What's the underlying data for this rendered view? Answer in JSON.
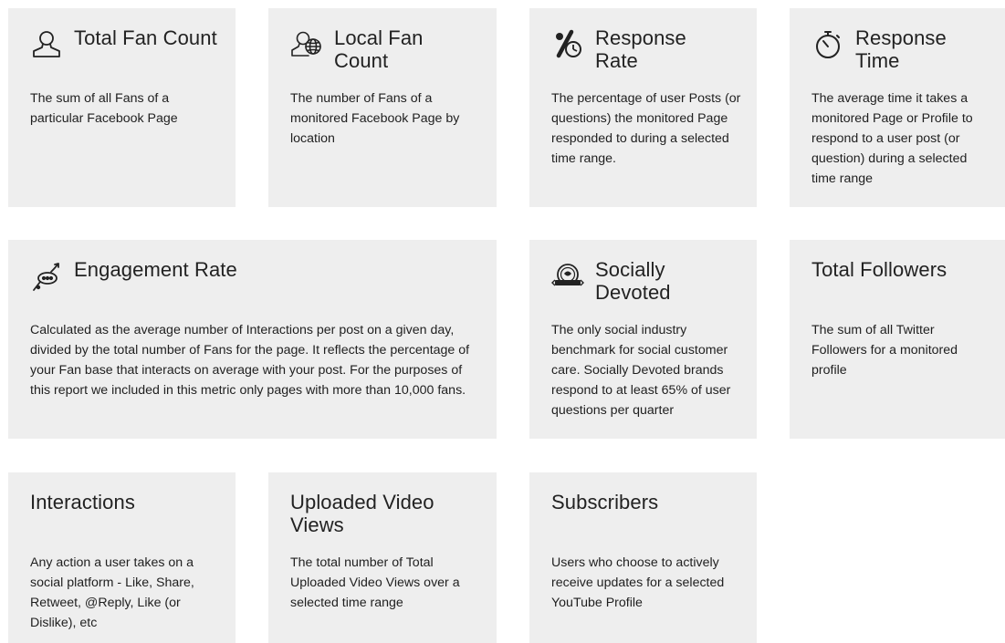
{
  "cards": {
    "total_fan_count": {
      "title": "Total Fan Count",
      "description": "The sum of all Fans of a particular Facebook Page",
      "icon": "user-outline-icon"
    },
    "local_fan_count": {
      "title": "Local Fan Count",
      "description": "The number of Fans of a monitored Facebook Page by location",
      "icon": "user-globe-icon"
    },
    "response_rate": {
      "title": "Response Rate",
      "description": "The percentage of user Posts (or questions) the monitored Page responded to during a selected time range.",
      "icon": "percent-clock-icon"
    },
    "response_time": {
      "title": "Response Time",
      "description": "The average time it takes a monitored Page or Profile to respond to a user post (or question) during a selected time range",
      "icon": "stopwatch-icon"
    },
    "engagement_rate": {
      "title": "Engagement Rate",
      "description": "Calculated as the average number of Interactions per post on a given day, divided by the total number of Fans for the page. It reflects the percentage of your Fan base that interacts on average with your post. For the purposes of this report we included in this metric only pages with more than 10,000 fans.",
      "icon": "engagement-chat-icon"
    },
    "socially_devoted": {
      "title": "Socially Devoted",
      "description": "The only social industry benchmark for social customer care. Socially Devoted brands respond to at least 65% of user questions per quarter",
      "icon": "socially-devoted-badge-icon"
    },
    "total_followers": {
      "title": "Total Followers",
      "description": "The sum of all Twitter Followers for a monitored profile"
    },
    "interactions": {
      "title": "Interactions",
      "description": "Any action a user takes on a social platform - Like, Share, Retweet, @Reply, Like (or Dislike), etc"
    },
    "uploaded_video_views": {
      "title": "Uploaded Video Views",
      "description": "The total number of Total Uploaded Video Views over a selected time range"
    },
    "subscribers": {
      "title": "Subscribers",
      "description": "Users who choose to actively receive updates for a selected YouTube Profile"
    }
  }
}
